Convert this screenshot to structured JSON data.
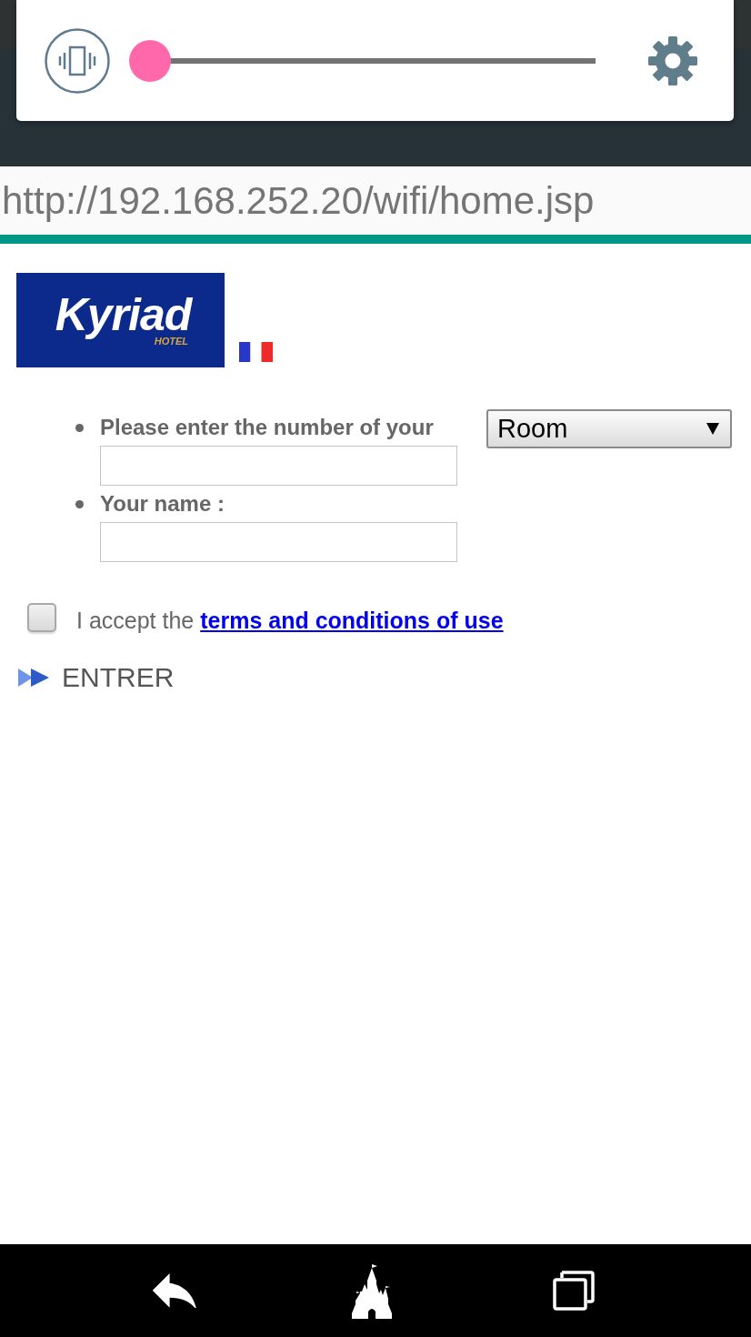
{
  "volume_panel": {
    "level": 0
  },
  "address_bar": {
    "url": "http://192.168.252.20/wifi/home.jsp",
    "load_progress": {
      "level": 1
    }
  },
  "page": {
    "logo": {
      "name": "Kyriad",
      "tagline": "HOTEL"
    },
    "form": {
      "fields": [
        {
          "label": "Please enter the number of your",
          "select": {
            "value": "Room"
          }
        },
        {
          "label": "Your name :"
        }
      ]
    },
    "terms": {
      "checked": false,
      "text": "I accept the",
      "link": "terms and conditions of use"
    },
    "submit": {
      "label": "ENTRER"
    }
  }
}
